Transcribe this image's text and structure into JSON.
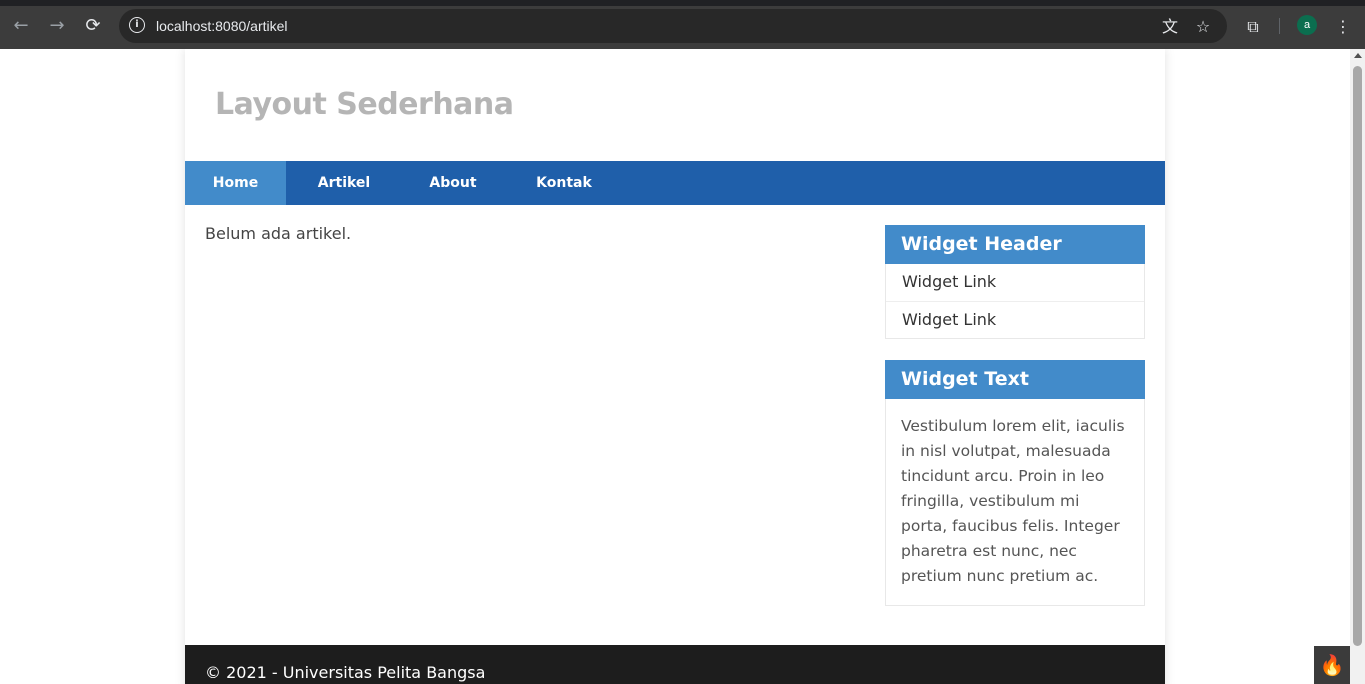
{
  "browser": {
    "url": "localhost:8080/artikel",
    "avatar_letter": "a",
    "icons": {
      "back": "arrow-left-icon",
      "forward": "arrow-right-icon",
      "reload": "reload-icon",
      "info": "info-icon",
      "translate": "translate-icon",
      "bookmark": "star-icon",
      "extensions": "puzzle-icon",
      "menu": "kebab-menu-icon"
    }
  },
  "site": {
    "title": "Layout Sederhana"
  },
  "nav": {
    "items": [
      {
        "label": "Home",
        "active": true
      },
      {
        "label": "Artikel",
        "active": false
      },
      {
        "label": "About",
        "active": false
      },
      {
        "label": "Kontak",
        "active": false
      }
    ]
  },
  "main": {
    "message": "Belum ada artikel."
  },
  "sidebar": {
    "widgets": [
      {
        "header": "Widget Header",
        "links": [
          "Widget Link",
          "Widget Link"
        ]
      },
      {
        "header": "Widget Text",
        "text": "Vestibulum lorem elit, iaculis in nisl volutpat, malesuada tincidunt arcu. Proin in leo fringilla, vestibulum mi porta, faucibus felis. Integer pharetra est nunc, nec pretium nunc pretium ac."
      }
    ]
  },
  "footer": {
    "text": "© 2021 - Universitas Pelita Bangsa"
  },
  "colors": {
    "nav_bg": "#1f5faa",
    "nav_active": "#428bca",
    "widget_header": "#428bca",
    "footer_bg": "#1d1d1d",
    "title": "#b5b5b5"
  },
  "debug_toolbar_icon": "codeigniter-flame-icon"
}
